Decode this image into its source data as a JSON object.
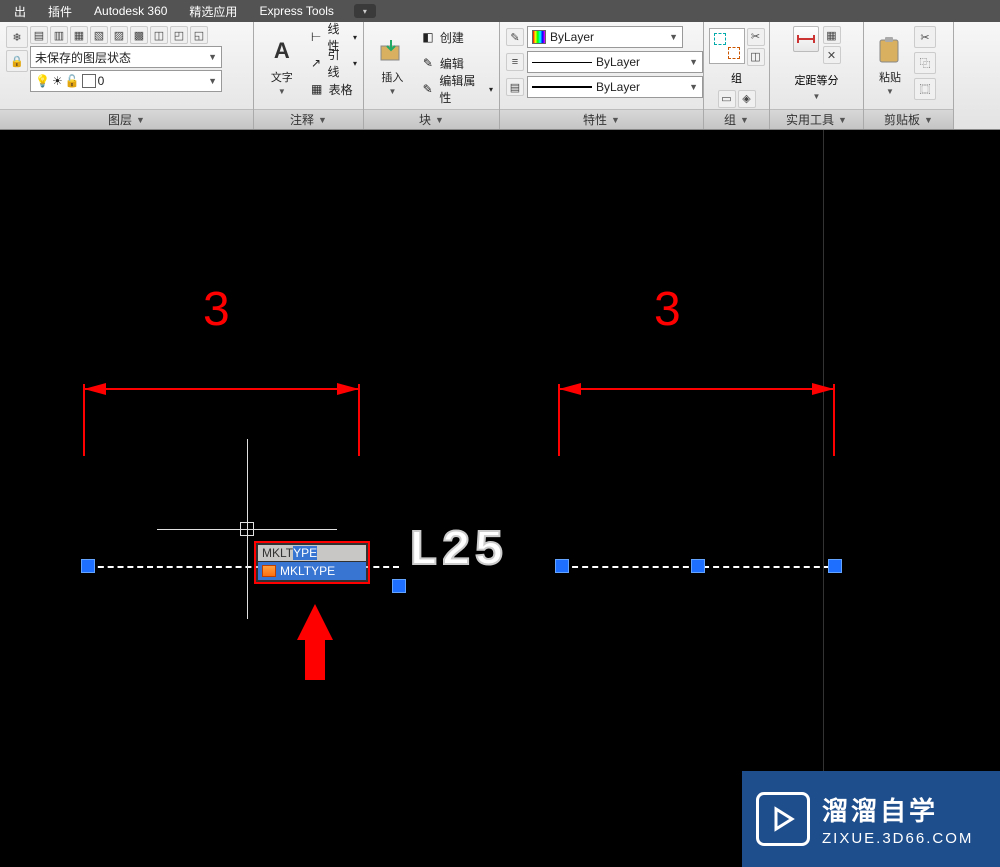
{
  "menu": {
    "items": [
      "出",
      "插件",
      "Autodesk 360",
      "精选应用",
      "Express Tools"
    ]
  },
  "ribbon": {
    "layers": {
      "unsaved_state": "未保存的图层状态",
      "current_layer": "0",
      "title": "图层"
    },
    "annotation": {
      "text": "文字",
      "linear": "线性",
      "leader": "引线",
      "table": "表格",
      "title": "注释"
    },
    "block": {
      "insert": "插入",
      "create": "创建",
      "edit": "编辑",
      "edit_attr": "编辑属性",
      "title": "块"
    },
    "properties": {
      "color": "ByLayer",
      "linetype": "ByLayer",
      "lineweight": "ByLayer",
      "title": "特性"
    },
    "group": {
      "label": "组",
      "title": "组"
    },
    "util": {
      "measure": "定距等分",
      "title": "实用工具"
    },
    "clipboard": {
      "paste": "粘贴",
      "title": "剪贴板"
    }
  },
  "canvas": {
    "dim1_text": "3",
    "dim2_text": "3",
    "entity_text": "L25",
    "cmd_typed_prefix": "MKLT",
    "cmd_typed_sel": "YPE",
    "cmd_suggestion": "MKLTYPE"
  },
  "watermark": {
    "line1": "溜溜自学",
    "line2": "ZIXUE.3D66.COM"
  }
}
